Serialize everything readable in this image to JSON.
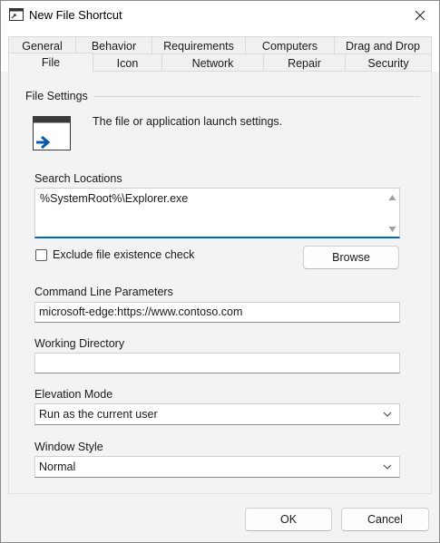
{
  "window": {
    "title": "New File Shortcut",
    "icon": "shortcut-window-icon"
  },
  "tabs_row1": [
    "General",
    "Behavior",
    "Requirements",
    "Computers",
    "Drag and Drop"
  ],
  "tabs_row2": [
    "File",
    "Icon",
    "Network",
    "Repair",
    "Security"
  ],
  "active_tab": "File",
  "section": {
    "title": "File Settings",
    "description": "The file or application launch settings."
  },
  "search_locations": {
    "label": "Search Locations",
    "value": "%SystemRoot%\\Explorer.exe"
  },
  "exclude_check": {
    "label": "Exclude file existence check",
    "checked": false
  },
  "browse_label": "Browse",
  "command_line": {
    "label": "Command Line Parameters",
    "value": "microsoft-edge:https://www.contoso.com"
  },
  "working_dir": {
    "label": "Working Directory",
    "value": ""
  },
  "elevation": {
    "label": "Elevation Mode",
    "selected": "Run as the current user"
  },
  "window_style": {
    "label": "Window Style",
    "selected": "Normal"
  },
  "footer": {
    "ok_label": "OK",
    "cancel_label": "Cancel"
  },
  "colors": {
    "accent": "#0067c0",
    "background": "#f3f3f3"
  }
}
